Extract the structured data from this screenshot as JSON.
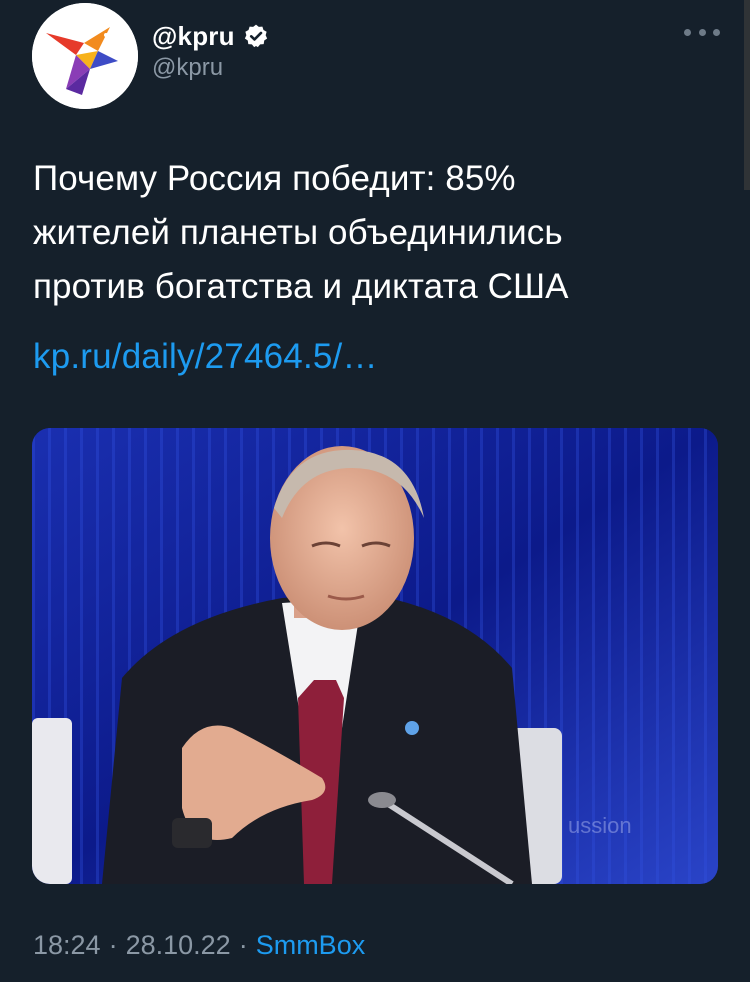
{
  "account": {
    "display_name": "@kpru",
    "handle": "@kpru",
    "verified": true,
    "avatar_icon": "kp-swallow-logo-icon"
  },
  "menu": {
    "icon": "more-options-icon"
  },
  "tweet": {
    "text_lines": [
      "Почему Россия победит: 85%",
      "жителей планеты объединились",
      "против богатства и диктата США"
    ],
    "link": "kp.ru/daily/27464.5/…",
    "media_icon": "tweet-photo"
  },
  "meta": {
    "time": "18:24",
    "sep1": "·",
    "date": "28.10.22",
    "sep2": "·",
    "source": "SmmBox"
  },
  "colors": {
    "background": "#15202b",
    "link": "#1d9bf0",
    "secondary_text": "#8b98a5"
  }
}
